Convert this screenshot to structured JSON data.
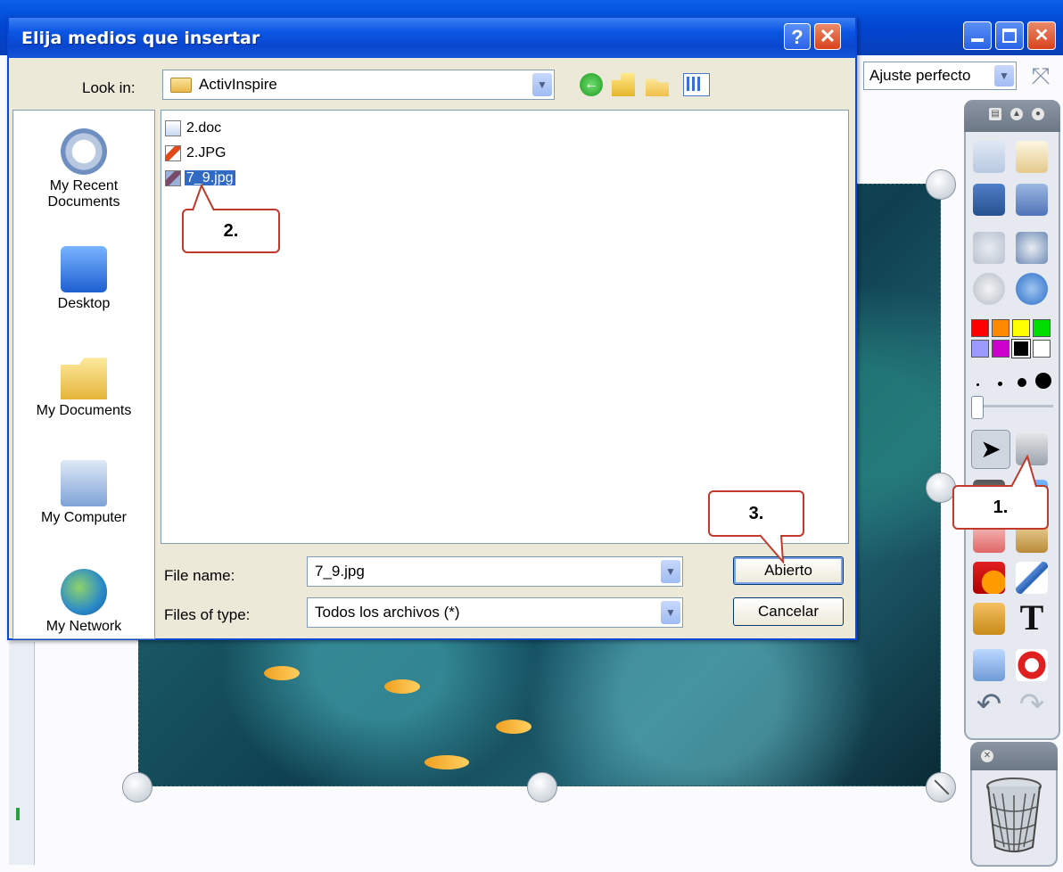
{
  "app": {
    "zoom_select": "Ajuste perfecto"
  },
  "dialog": {
    "title": "Elija medios que insertar",
    "help_label": "?",
    "close_label": "✕",
    "look_in_label": "Look in:",
    "look_in_value": "ActivInspire",
    "places": [
      {
        "label_line1": "My Recent",
        "label_line2": "Documents",
        "icon": "recent-documents-icon"
      },
      {
        "label_line1": "Desktop",
        "label_line2": "",
        "icon": "desktop-icon"
      },
      {
        "label_line1": "My Documents",
        "label_line2": "",
        "icon": "my-documents-icon"
      },
      {
        "label_line1": "My Computer",
        "label_line2": "",
        "icon": "my-computer-icon"
      },
      {
        "label_line1": "My Network",
        "label_line2": "",
        "icon": "network-icon"
      }
    ],
    "files": [
      {
        "name": "2.doc",
        "icon": "word-document-icon",
        "selected": false
      },
      {
        "name": "2.JPG",
        "icon": "image-file-icon",
        "selected": false
      },
      {
        "name": "7_9.jpg",
        "icon": "image-file-icon",
        "selected": true
      }
    ],
    "file_name_label": "File name:",
    "file_name_value": "7_9.jpg",
    "file_type_label": "Files of type:",
    "file_type_value": "Todos los archivos (*)",
    "open_label": "Abierto",
    "cancel_label": "Cancelar"
  },
  "callouts": {
    "step1": "1.",
    "step2": "2.",
    "step3": "3."
  },
  "colors": {
    "accent": "#0a48d4",
    "callout_border": "#c0392b",
    "selection": "#316ac5"
  }
}
